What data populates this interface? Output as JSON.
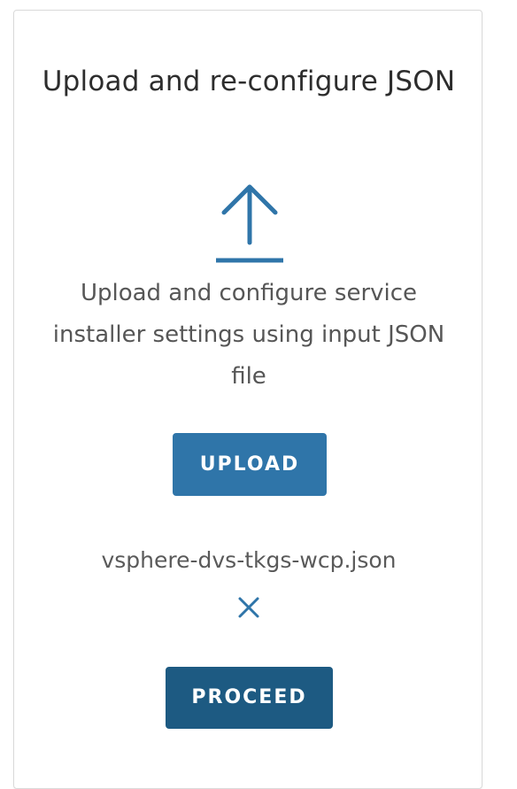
{
  "card": {
    "title": "Upload and re-configure JSON",
    "description": "Upload and configure service installer settings using input JSON file",
    "upload_icon": "upload-arrow-icon",
    "upload_button_label": "UPLOAD",
    "selected_file": "vsphere-dvs-tkgs-wcp.json",
    "remove_icon": "close-x-icon",
    "proceed_button_label": "PROCEED"
  },
  "colors": {
    "accent": "#2f75a9",
    "accent_dark": "#1d5a82",
    "icon": "#2f75a9"
  }
}
